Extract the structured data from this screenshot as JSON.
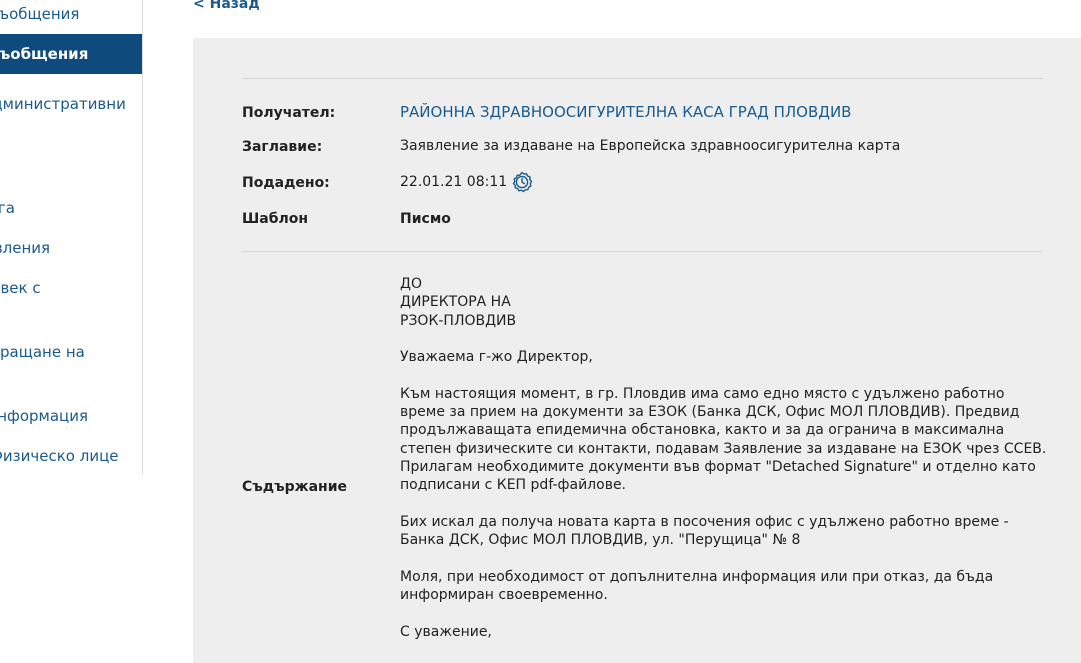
{
  "sidebar": {
    "items": [
      {
        "label": "Съобщения"
      },
      {
        "label": "Съобщения"
      },
      {
        "label": "Административни"
      },
      {
        "label": "Услуга"
      },
      {
        "label": "Заявления"
      },
      {
        "label": "Човек с"
      },
      {
        "label": "Изпращане на"
      },
      {
        "label": "Информация"
      },
      {
        "label": "Физическо лице"
      }
    ]
  },
  "header": {
    "back_label": "< Назад"
  },
  "details": {
    "recipient_label": "Получател:",
    "recipient_value": "РАЙОННА ЗДРАВНООСИГУРИТЕЛНА КАСА ГРАД ПЛОВДИВ",
    "title_label": "Заглавие:",
    "title_value": "Заявление за издаване на Европейска здравноосигурителна карта",
    "submitted_label": "Подадено:",
    "submitted_value": "22.01.21 08:11",
    "template_label": "Шаблон",
    "template_value": "Писмо",
    "content_label": "Съдържание"
  },
  "content": {
    "p1_line1": "ДО",
    "p1_line2": "ДИРЕКТОРА НА",
    "p1_line3": "РЗОК-ПЛОВДИВ",
    "p2": "Уважаема г-жо Директор,",
    "p3": "Към настоящия момент, в гр. Пловдив има само едно място с удължено работно време за прием на документи за ЕЗОК (Банка ДСК, Офис МОЛ ПЛОВДИВ). Предвид продължаващата епидемична обстановка, както и за да огранича в максимална степен физическите си контакти, подавам Заявление за издаване на ЕЗОК чрез ССЕВ. Прилагам необходимите документи във формат \"Detached Signature\" и отделно като подписани с КЕП pdf-файлове.",
    "p4": "Бих искал да получа новата карта в посочения офис с удължено работно време - Банка ДСК, Офис МОЛ ПЛОВДИВ, ул. \"Перущица\" № 8",
    "p5": "Моля, при необходимост от допълнителна информация или при отказ, да бъда информиран своевременно.",
    "p6": "С уважение,"
  },
  "colors": {
    "accent": "#0e4a7b",
    "link": "#1a5a8e",
    "panel_bg": "#eeeeee"
  }
}
